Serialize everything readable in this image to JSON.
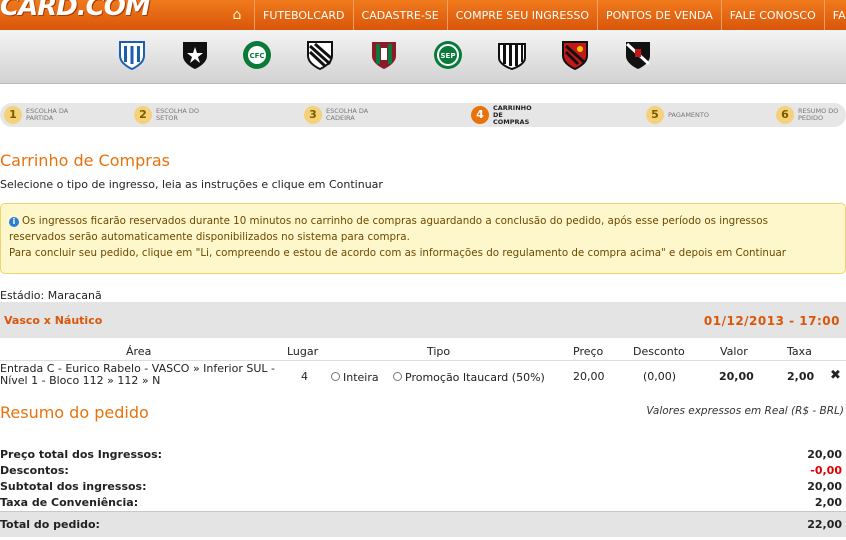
{
  "header": {
    "logo_text": "CARD.COM",
    "nav": [
      "FUTEBOLCARD",
      "CADASTRE-SE",
      "COMPRE SEU INGRESSO",
      "PONTOS DE VENDA",
      "FALE CONOSCO",
      "FAQ"
    ],
    "home_icon": "home-icon"
  },
  "teams": [
    {
      "name": "avai",
      "icon": "avai-crest-icon",
      "color": "#1c5fb0"
    },
    {
      "name": "botafogo",
      "icon": "botafogo-crest-icon",
      "color": "#111111"
    },
    {
      "name": "coritiba",
      "icon": "coritiba-crest-icon",
      "color": "#0a7a3a"
    },
    {
      "name": "figueirense",
      "icon": "figueirense-crest-icon",
      "color": "#111111"
    },
    {
      "name": "fluminense",
      "icon": "fluminense-crest-icon",
      "color": "#8b1a2b"
    },
    {
      "name": "palmeiras",
      "icon": "palmeiras-crest-icon",
      "color": "#0a7a3a"
    },
    {
      "name": "santos",
      "icon": "santos-crest-icon",
      "color": "#111111"
    },
    {
      "name": "sport",
      "icon": "sport-crest-icon",
      "color": "#c41818"
    },
    {
      "name": "vasco",
      "icon": "vasco-crest-icon",
      "color": "#111111"
    }
  ],
  "steps": [
    {
      "num": "1",
      "label": "ESCOLHA DA PARTIDA"
    },
    {
      "num": "2",
      "label": "ESCOLHA DO SETOR"
    },
    {
      "num": "3",
      "label": "ESCOLHA DA CADEIRA"
    },
    {
      "num": "4",
      "label": "CARRINHO DE COMPRAS"
    },
    {
      "num": "5",
      "label": "PAGAMENTO"
    },
    {
      "num": "6",
      "label": "RESUMO DO PEDIDO"
    }
  ],
  "page": {
    "title": "Carrinho de Compras",
    "instructions": "Selecione o tipo de ingresso, leia as instruções e clique em Continuar"
  },
  "notice": {
    "line1": "Os ingressos ficarão reservados durante 10 minutos no carrinho de compras aguardando a conclusão do pedido, após esse período os ingressos",
    "line2": "reservados serão automaticamente disponibilizados no sistema para compra.",
    "line3": "Para concluir seu pedido, clique em \"Li, compreendo e estou de acordo com as informações do regulamento de compra acima\" e depois em Continuar"
  },
  "stadium": "Estádio: Maracanã",
  "match": {
    "name": "Vasco x Náutico",
    "date": "01/12/2013 - 17:00"
  },
  "table": {
    "headers": {
      "area": "Área",
      "lugar": "Lugar",
      "tipo": "Tipo",
      "preco": "Preço",
      "desconto": "Desconto",
      "valor": "Valor",
      "taxa": "Taxa"
    },
    "row": {
      "area_line1": "Entrada C - Eurico Rabelo - VASCO » Inferior SUL -",
      "area_line2": "Nível 1 - Bloco 112 » 112 » N",
      "lugar": "4",
      "tipo_option1": "Inteira",
      "tipo_option2": "Promoção Itaucard (50%)",
      "preco": "20,00",
      "desconto": "(0,00)",
      "valor": "20,00",
      "taxa": "2,00",
      "remove_icon": "close-icon"
    }
  },
  "summary": {
    "title": "Resumo do pedido",
    "currency_note": "Valores expressos em Real (R$ - BRL)",
    "rows": [
      {
        "label": "Preço total dos Ingressos:",
        "value": "20,00"
      },
      {
        "label": "Descontos:",
        "value": "-0,00"
      },
      {
        "label": "Subtotal dos ingressos:",
        "value": "20,00"
      },
      {
        "label": "Taxa de Conveniência:",
        "value": "2,00"
      }
    ],
    "total_label": "Total do pedido:",
    "total_value": "22,00"
  }
}
